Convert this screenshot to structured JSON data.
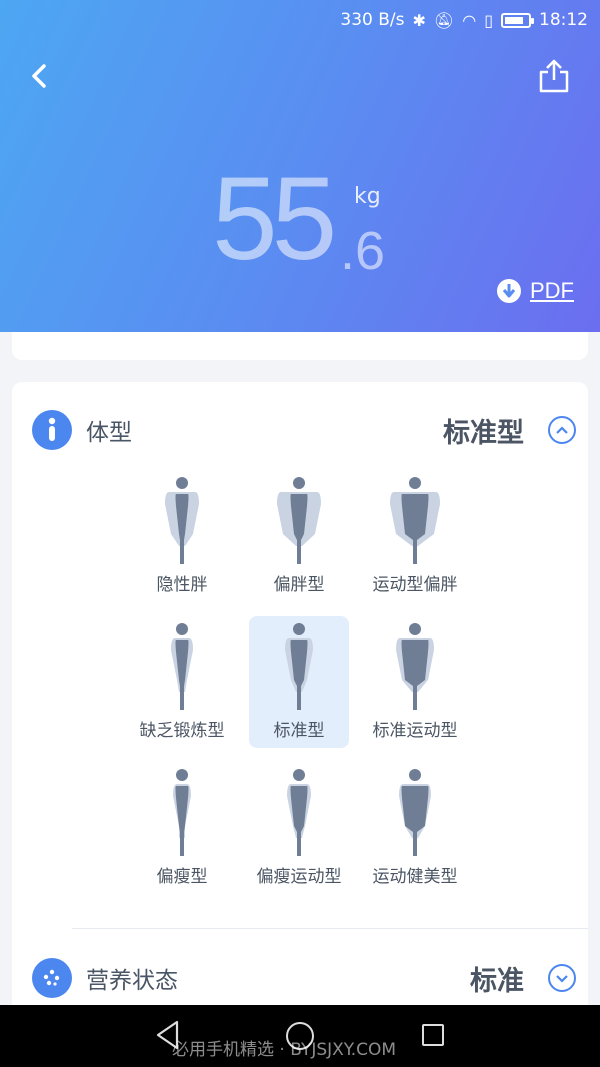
{
  "status_bar": {
    "speed": "330 B/s",
    "time": "18:12",
    "icons": [
      "bluetooth-icon",
      "mute-icon",
      "wifi-icon",
      "alert-icon",
      "battery-icon"
    ]
  },
  "header": {
    "weight_main": "55",
    "weight_decimal": ".6",
    "unit": "kg",
    "pdf_label": "PDF",
    "colors": {
      "gradient_start": "#4da7f3",
      "gradient_end": "#6b6ef0"
    }
  },
  "body_type": {
    "title": "体型",
    "value": "标准型",
    "options": [
      {
        "label": "隐性胖"
      },
      {
        "label": "偏胖型"
      },
      {
        "label": "运动型偏胖"
      },
      {
        "label": "缺乏锻炼型"
      },
      {
        "label": "标准型",
        "selected": true
      },
      {
        "label": "标准运动型"
      },
      {
        "label": "偏瘦型"
      },
      {
        "label": "偏瘦运动型"
      },
      {
        "label": "运动健美型"
      }
    ]
  },
  "nutrition": {
    "title": "营养状态",
    "value": "标准"
  },
  "watermark": "必用手机精选 · BYJSJXY.COM",
  "accent_color": "#4c86ef"
}
